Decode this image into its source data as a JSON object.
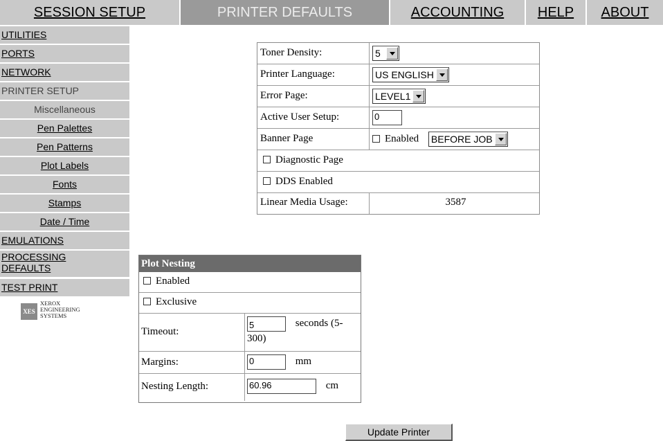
{
  "topnav": {
    "session_setup": "SESSION SETUP",
    "printer_defaults": "PRINTER DEFAULTS",
    "accounting": "ACCOUNTING",
    "help": "HELP",
    "about": "ABOUT"
  },
  "sidebar": {
    "utilities": "UTILITIES",
    "ports": "PORTS",
    "network": "NETWORK",
    "printer_setup": "PRINTER SETUP",
    "miscellaneous": "Miscellaneous",
    "pen_palettes": "Pen Palettes",
    "pen_patterns": "Pen Patterns",
    "plot_labels": "Plot Labels",
    "fonts": "Fonts",
    "stamps": "Stamps",
    "date_time": "Date / Time",
    "emulations": "EMULATIONS",
    "processing_line1": "PROCESSING",
    "processing_line2": "DEFAULTS",
    "test_print": "TEST PRINT",
    "logo_box": "XES",
    "logo_line1": "XEROX",
    "logo_line2": "ENGINEERING",
    "logo_line3": "SYSTEMS"
  },
  "settings": {
    "toner_density_label": "Toner Density:",
    "toner_density_value": "5",
    "printer_language_label": "Printer Language:",
    "printer_language_value": "US ENGLISH",
    "error_page_label": "Error Page:",
    "error_page_value": "LEVEL1",
    "active_user_label": "Active User Setup:",
    "active_user_value": "0",
    "banner_page_label": "Banner Page",
    "banner_enabled_label": "Enabled",
    "banner_position_value": "BEFORE JOB",
    "diagnostic_page_label": "Diagnostic Page",
    "dds_enabled_label": "DDS Enabled",
    "linear_media_label": "Linear Media Usage:",
    "linear_media_value": "3587"
  },
  "nesting": {
    "title": "Plot Nesting",
    "enabled_label": "Enabled",
    "exclusive_label": "Exclusive",
    "timeout_label": "Timeout:",
    "timeout_value": "5",
    "timeout_unit_line1": "seconds (5-",
    "timeout_unit_line2": "300)",
    "margins_label": "Margins:",
    "margins_value": "0",
    "margins_unit": "mm",
    "nesting_length_label": "Nesting Length:",
    "nesting_length_value": "60.96",
    "nesting_length_unit": "cm"
  },
  "update_button": "Update Printer"
}
